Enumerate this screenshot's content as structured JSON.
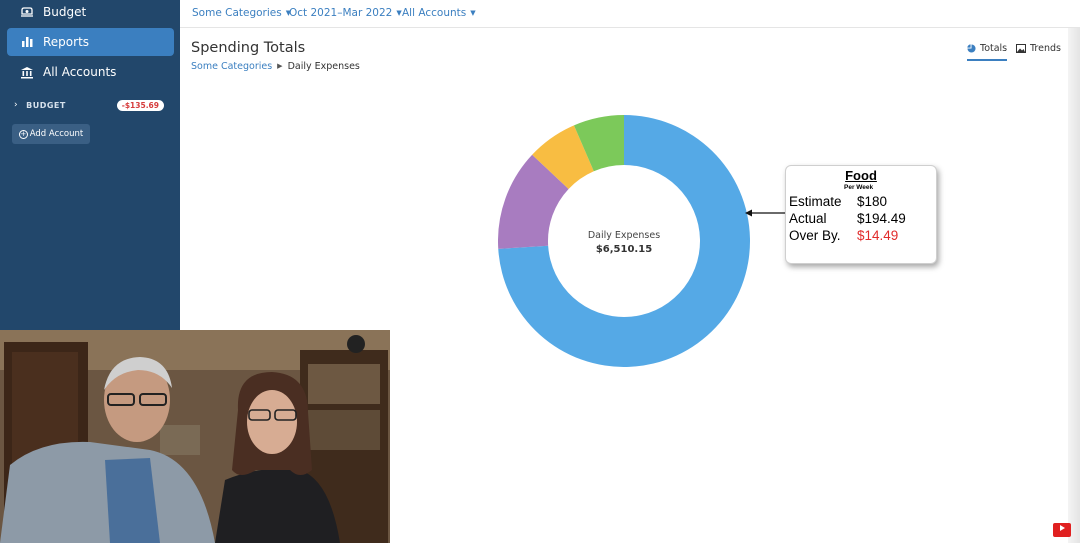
{
  "sidebar": {
    "items": [
      {
        "label": "Budget",
        "icon": "piggy-bank-icon",
        "active": false
      },
      {
        "label": "Reports",
        "icon": "bar-chart-icon",
        "active": true
      },
      {
        "label": "All Accounts",
        "icon": "bank-icon",
        "active": false
      }
    ],
    "budget_group": {
      "label": "BUDGET",
      "balance": "-$135.69"
    },
    "add_account_label": "Add Account"
  },
  "filters": {
    "categories": "Some Categories",
    "date_range": "Oct 2021–Mar 2022",
    "accounts": "All Accounts"
  },
  "header": {
    "title": "Spending Totals",
    "breadcrumb": {
      "parent": "Some Categories",
      "current": "Daily Expenses"
    }
  },
  "view_tabs": [
    {
      "label": "Totals",
      "icon": "pie-chart-icon",
      "active": true
    },
    {
      "label": "Trends",
      "icon": "image-icon",
      "active": false
    }
  ],
  "chart_data": {
    "type": "pie",
    "categories": [
      "",
      "",
      "",
      ""
    ],
    "shares": [
      0.74,
      0.13,
      0.065,
      0.065
    ],
    "colors": [
      "#55a9e6",
      "#a87cc0",
      "#f8bd42",
      "#7cc95a"
    ],
    "center_label": "Daily Expenses",
    "center_value": "$6,510.15"
  },
  "callout": {
    "title": "Food",
    "subtitle": "Per Week",
    "rows": [
      {
        "label": "Estimate",
        "value": "$180"
      },
      {
        "label": "Actual",
        "value": "$194.49"
      },
      {
        "label": "Over By.",
        "value": "$14.49"
      }
    ],
    "over_color": "#e12b2b"
  },
  "colors": {
    "sidebar_bg": "#22476b",
    "accent": "#3b7fc0",
    "negative": "#d63b3b"
  }
}
